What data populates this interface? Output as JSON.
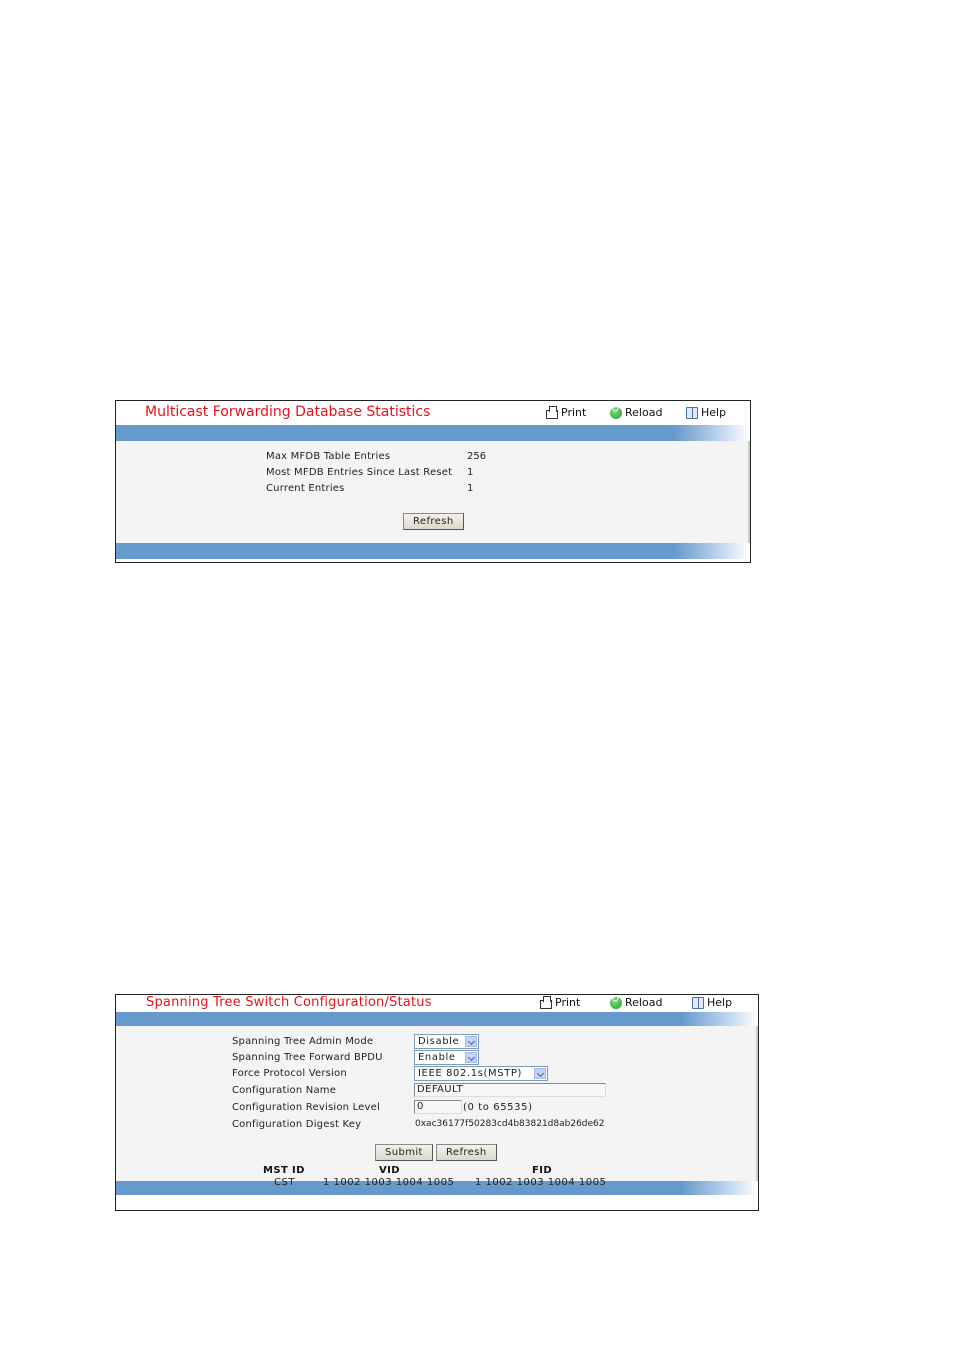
{
  "panel1": {
    "title": "Multicast Forwarding Database Statistics",
    "toolbar": {
      "print": "Print",
      "reload": "Reload",
      "help": "Help"
    },
    "rows": [
      {
        "label": "Max MFDB Table Entries",
        "value": "256"
      },
      {
        "label": "Most MFDB Entries Since Last Reset",
        "value": "1"
      },
      {
        "label": "Current Entries",
        "value": "1"
      }
    ],
    "refresh_label": "Refresh"
  },
  "panel2": {
    "title": "Spanning Tree Switch Configuration/Status",
    "toolbar": {
      "print": "Print",
      "reload": "Reload",
      "help": "Help"
    },
    "fields": {
      "admin_mode": {
        "label": "Spanning Tree Admin Mode",
        "value": "Disable"
      },
      "forward_bpdu": {
        "label": "Spanning Tree Forward BPDU",
        "value": "Enable"
      },
      "protocol_version": {
        "label": "Force Protocol Version",
        "value": "IEEE 802.1s(MSTP)"
      },
      "config_name": {
        "label": "Configuration Name",
        "value": "DEFAULT"
      },
      "revision_level": {
        "label": "Configuration Revision Level",
        "value": "0",
        "hint": "(0 to 65535)"
      },
      "digest_key": {
        "label": "Configuration Digest Key",
        "value": "0xac36177f50283cd4b83821d8ab26de62"
      }
    },
    "submit_label": "Submit",
    "refresh_label": "Refresh",
    "table": {
      "headers": [
        "MST ID",
        "VID",
        "FID"
      ],
      "rows": [
        [
          "CST",
          "1 1002 1003 1004 1005",
          "1 1002 1003 1004 1005"
        ]
      ]
    }
  }
}
